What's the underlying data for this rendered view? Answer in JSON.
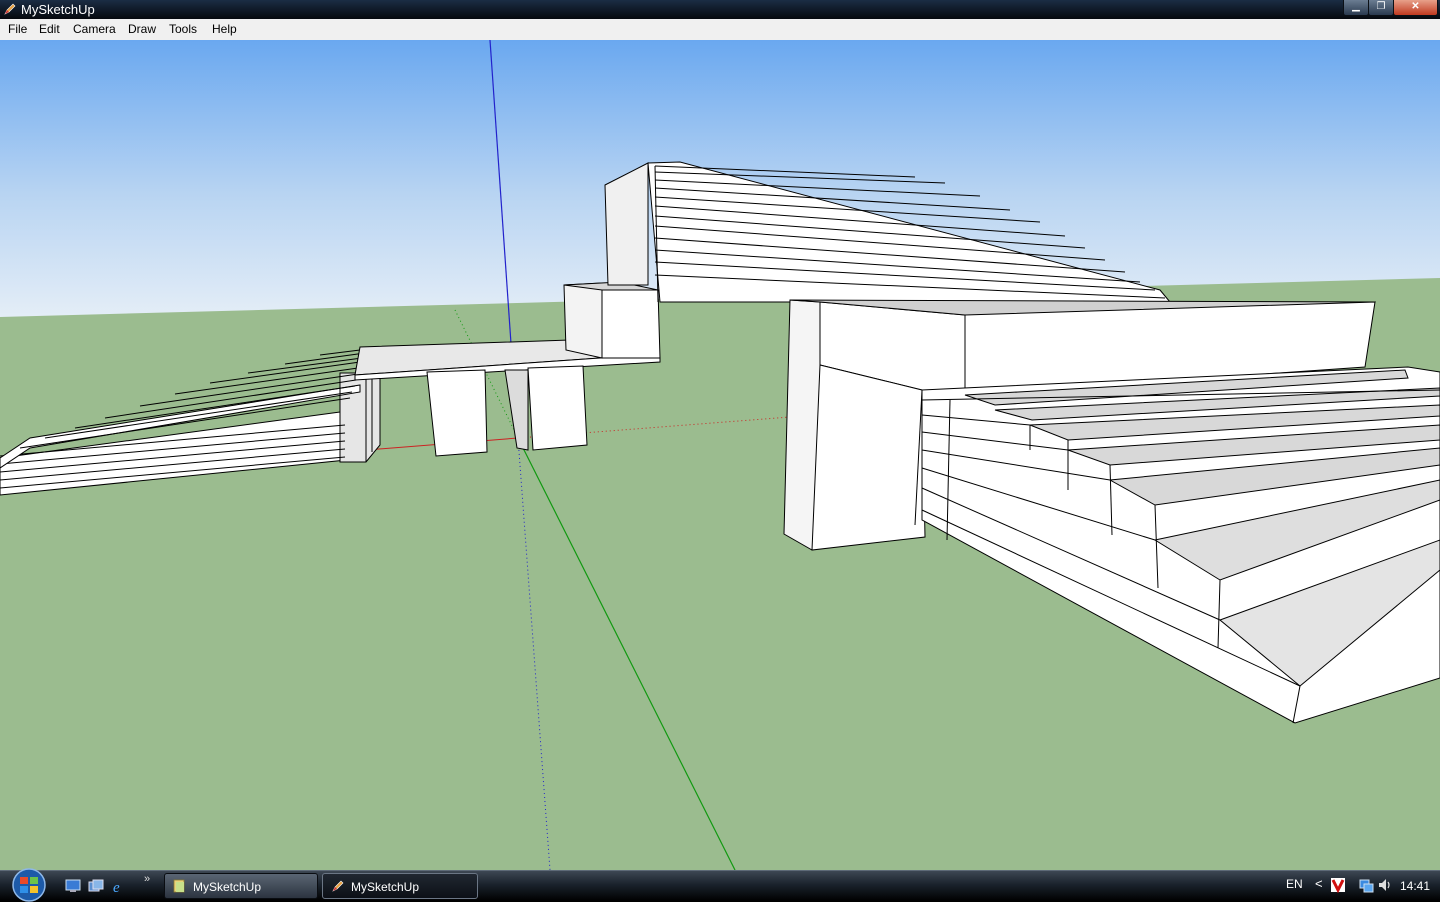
{
  "window": {
    "title": "MySketchUp",
    "icon": "sketchup-pencil-icon",
    "controls": {
      "minimize": "minimize-icon",
      "maximize": "restore-icon",
      "close": "close-icon"
    }
  },
  "menu": {
    "items": [
      {
        "label": "File"
      },
      {
        "label": "Edit"
      },
      {
        "label": "Camera"
      },
      {
        "label": "Draw"
      },
      {
        "label": "Tools"
      },
      {
        "label": "Help"
      }
    ]
  },
  "viewport": {
    "sky_top": "#7fb4f4",
    "sky_bottom": "#e3eef8",
    "ground": "#9bbc8f",
    "axis_red": "#cc2222",
    "axis_green": "#119911",
    "axis_blue": "#2222cc",
    "face": "#ffffff",
    "face_shaded": "#d8d8d8",
    "edge": "#000000"
  },
  "taskbar": {
    "start": "windows-start-icon",
    "quick_launch": [
      "show-desktop-icon",
      "switch-windows-icon",
      "internet-explorer-icon"
    ],
    "chevron": "»",
    "tasks": [
      {
        "label": "MySketchUp",
        "icon": "folder-icon",
        "active": false
      },
      {
        "label": "MySketchUp",
        "icon": "sketchup-pencil-icon",
        "active": true
      }
    ],
    "language": "EN",
    "tray_chevron": "<",
    "tray_icons": [
      "antivirus-icon",
      "network-icon",
      "volume-icon"
    ],
    "clock": "14:41"
  }
}
